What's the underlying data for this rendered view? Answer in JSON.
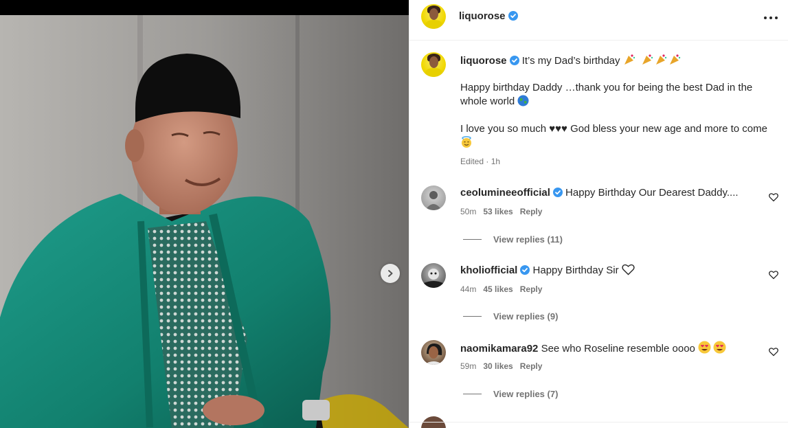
{
  "post": {
    "username": "liquorose",
    "more_icon": "more-horizontal-icon"
  },
  "caption": {
    "username": "liquorose",
    "line1": "It’s my Dad’s birthday",
    "para1": "Happy birthday Daddy …thank you for being the best Dad in the whole world",
    "para2a": "I love you so much ♥♥♥ God bless your new age and more to come",
    "edited": "Edited",
    "time": "1h"
  },
  "comments": [
    {
      "username": "ceolumineeofficial",
      "text": "Happy Birthday Our Dearest Daddy....",
      "time": "50m",
      "likes": "53 likes",
      "reply": "Reply",
      "view_replies": "View replies (11)"
    },
    {
      "username": "kholiofficial",
      "text": "Happy Birthday Sir",
      "time": "44m",
      "likes": "45 likes",
      "reply": "Reply",
      "view_replies": "View replies (9)"
    },
    {
      "username": "naomikamara92",
      "text": "See who Roseline resemble oooo",
      "time": "59m",
      "likes": "30 likes",
      "reply": "Reply",
      "view_replies": "View replies (7)"
    }
  ],
  "colors": {
    "verified": "#3897f0",
    "text": "#262626",
    "muted": "#737373",
    "border": "#efefef"
  }
}
